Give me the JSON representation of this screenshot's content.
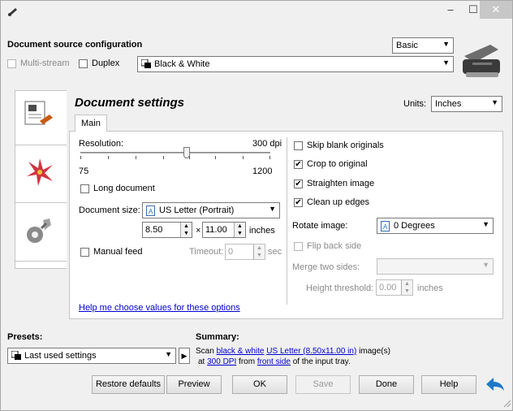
{
  "window": {
    "minimize_glyph": "–",
    "maximize_glyph": "☐",
    "close_glyph": "✕"
  },
  "source_config": {
    "title": "Document source configuration",
    "profile_mode": "Basic",
    "multistream_label": "Multi-stream",
    "duplex_label": "Duplex",
    "color_mode": "Black & White"
  },
  "settings": {
    "title": "Document settings",
    "units_label": "Units:",
    "units_value": "Inches",
    "tab_main": "Main",
    "resolution_label": "Resolution:",
    "resolution_value": "300 dpi",
    "resolution_dpi": 300,
    "resolution_min": "75",
    "resolution_max": "1200",
    "long_document_label": "Long document",
    "document_size_label": "Document size:",
    "document_size_value": "US Letter (Portrait)",
    "width_value": "8.50",
    "times": "×",
    "height_value": "11.00",
    "size_unit": "inches",
    "manual_feed_label": "Manual feed",
    "timeout_label": "Timeout:",
    "timeout_value": "0",
    "timeout_unit": "sec",
    "help_link": "Help me choose values for these options",
    "skip_blank_label": "Skip blank originals",
    "crop_label": "Crop to original",
    "straighten_label": "Straighten image",
    "clean_edges_label": "Clean up edges",
    "rotate_label": "Rotate image:",
    "rotate_value": "0 Degrees",
    "flip_label": "Flip back side",
    "merge_label": "Merge two sides:",
    "merge_value": "",
    "height_threshold_label": "Height threshold:",
    "height_threshold_value": "0.00",
    "height_threshold_unit": "inches",
    "check_glyph": "✔"
  },
  "presets": {
    "label": "Presets:",
    "value": "Last used settings"
  },
  "summary": {
    "label": "Summary:",
    "scan": "Scan",
    "color": "black & white",
    "size": "US Letter (8.50x11.00 in)",
    "images": "image(s)",
    "at": "at",
    "dpi": "300 DPI",
    "from": "from",
    "side": "front side",
    "tail": "of the input tray."
  },
  "buttons": {
    "restore": "Restore defaults",
    "preview": "Preview",
    "ok": "OK",
    "save": "Save",
    "done": "Done",
    "help": "Help"
  },
  "colors": {
    "link": "#0000d0",
    "back_arrow": "#1e78c8",
    "close_button": "#c7c7c7"
  }
}
